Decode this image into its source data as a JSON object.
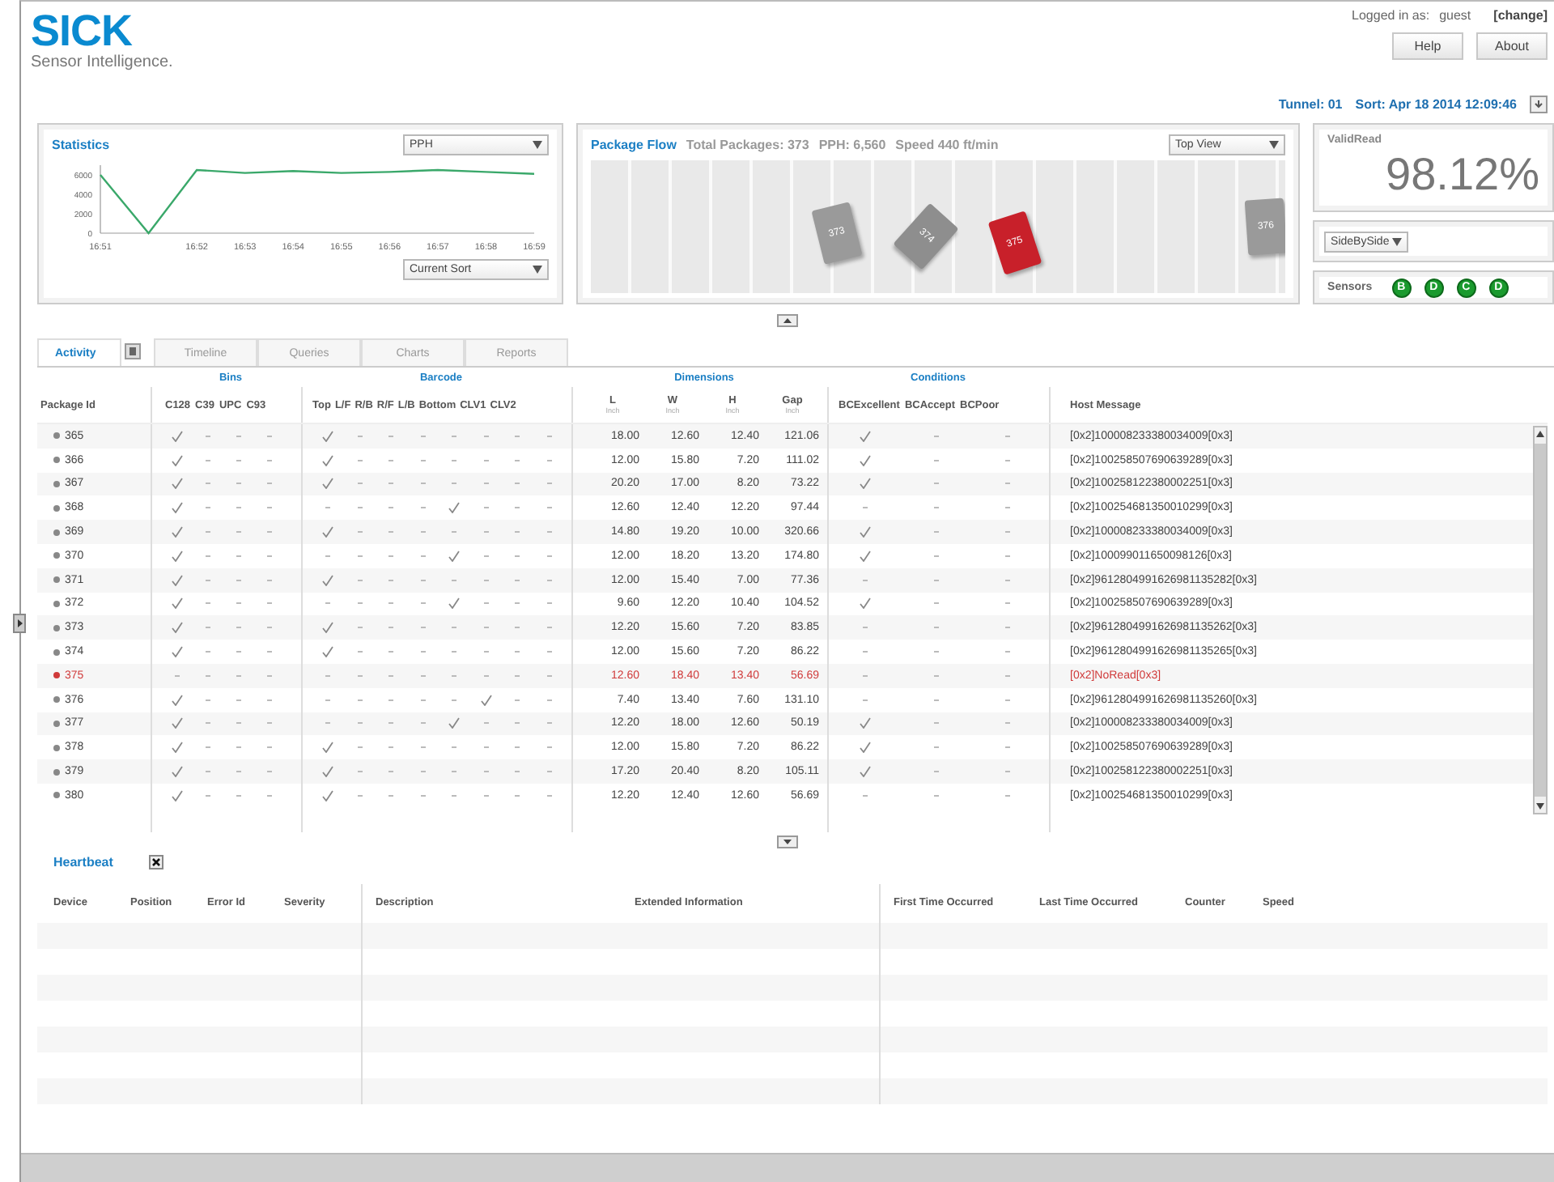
{
  "header": {
    "logo": "SICK",
    "tagline": "Sensor Intelligence.",
    "login_label": "Logged in as:",
    "user": "guest",
    "change_link": "[change]",
    "buttons": [
      "Help",
      "About"
    ],
    "tunnel": "Tunnel: 01",
    "sort": "Sort: Apr 18 2014 12:09:46"
  },
  "statistics": {
    "title": "Statistics",
    "metric_select": "PPH",
    "sort_select": "Current Sort",
    "chart_data": {
      "type": "line",
      "categories": [
        "16:51",
        null,
        "16:52",
        "16:53",
        "16:54",
        "16:55",
        "16:56",
        "16:57",
        "16:58",
        "16:59"
      ],
      "ylim": [
        0,
        7000
      ],
      "yticks": [
        0,
        2000,
        4000,
        6000
      ],
      "series": [
        {
          "color": "#3aa86a",
          "values": [
            6000,
            0,
            6500,
            6200,
            6400,
            6200,
            6300,
            6500,
            6300,
            6100
          ]
        }
      ]
    }
  },
  "package_flow": {
    "title": "Package Flow",
    "total": "Total Packages: 373",
    "pph": "PPH: 6,560",
    "speed": "Speed 440 ft/min",
    "view_select": "Top View",
    "packages": [
      {
        "label": "373",
        "color": "#9a9a9a"
      },
      {
        "label": "374",
        "color": "#8e8e8e"
      },
      {
        "label": "375",
        "color": "#c8202a"
      },
      {
        "label": "376",
        "color": "#9a9a9a"
      }
    ]
  },
  "valid_read": {
    "title": "ValidRead",
    "value": "98.12%"
  },
  "layout_select": "SideBySide",
  "sensors": {
    "label": "Sensors",
    "items": [
      {
        "letter": "B",
        "color": "#1a9a2e"
      },
      {
        "letter": "D",
        "color": "#1a9a2e"
      },
      {
        "letter": "C",
        "color": "#1a9a2e"
      },
      {
        "letter": "D",
        "color": "#1a9a2e"
      }
    ]
  },
  "tabs": [
    {
      "label": "Activity",
      "selected": true
    },
    {
      "label": "Timeline",
      "selected": false
    },
    {
      "label": "Queries",
      "selected": false
    },
    {
      "label": "Charts",
      "selected": false
    },
    {
      "label": "Reports",
      "selected": false
    }
  ],
  "activity": {
    "package_id_header": "Package Id",
    "bins": {
      "title": "Bins",
      "columns": [
        "C128",
        "C39",
        "UPC",
        "C93"
      ]
    },
    "barcode": {
      "title": "Barcode",
      "columns": [
        "Top",
        "L/F",
        "R/B",
        "R/F",
        "L/B",
        "Bottom",
        "CLV1",
        "CLV2"
      ]
    },
    "dimensions": {
      "title": "Dimensions",
      "columns": [
        {
          "label": "L",
          "unit": "Inch"
        },
        {
          "label": "W",
          "unit": "Inch"
        },
        {
          "label": "H",
          "unit": "Inch"
        },
        {
          "label": "Gap",
          "unit": "Inch"
        }
      ]
    },
    "conditions": {
      "title": "Conditions",
      "columns": [
        "BCExcellent",
        "BCAccept",
        "BCPoor"
      ]
    },
    "host_message_header": "Host Message",
    "rows": [
      {
        "id": "365",
        "error": false,
        "bins": [
          true,
          false,
          false,
          false
        ],
        "barcode": [
          true,
          false,
          false,
          false,
          false,
          false,
          false,
          false
        ],
        "dims": [
          "18.00",
          "12.60",
          "12.40",
          "121.06"
        ],
        "conditions": [
          true,
          false,
          false
        ],
        "host_message": "[0x2]100008233380034009[0x3]"
      },
      {
        "id": "366",
        "error": false,
        "bins": [
          true,
          false,
          false,
          false
        ],
        "barcode": [
          true,
          false,
          false,
          false,
          false,
          false,
          false,
          false
        ],
        "dims": [
          "12.00",
          "15.80",
          "7.20",
          "111.02"
        ],
        "conditions": [
          true,
          false,
          false
        ],
        "host_message": "[0x2]100258507690639289[0x3]"
      },
      {
        "id": "367",
        "error": false,
        "bins": [
          true,
          false,
          false,
          false
        ],
        "barcode": [
          true,
          false,
          false,
          false,
          false,
          false,
          false,
          false
        ],
        "dims": [
          "20.20",
          "17.00",
          "8.20",
          "73.22"
        ],
        "conditions": [
          true,
          false,
          false
        ],
        "host_message": "[0x2]100258122380002251[0x3]"
      },
      {
        "id": "368",
        "error": false,
        "bins": [
          true,
          false,
          false,
          false
        ],
        "barcode": [
          false,
          false,
          false,
          false,
          true,
          false,
          false,
          false
        ],
        "dims": [
          "12.60",
          "12.40",
          "12.20",
          "97.44"
        ],
        "conditions": [
          false,
          false,
          false
        ],
        "host_message": "[0x2]100254681350010299[0x3]"
      },
      {
        "id": "369",
        "error": false,
        "bins": [
          true,
          false,
          false,
          false
        ],
        "barcode": [
          true,
          false,
          false,
          false,
          false,
          false,
          false,
          false
        ],
        "dims": [
          "14.80",
          "19.20",
          "10.00",
          "320.66"
        ],
        "conditions": [
          true,
          false,
          false
        ],
        "host_message": "[0x2]100008233380034009[0x3]"
      },
      {
        "id": "370",
        "error": false,
        "bins": [
          true,
          false,
          false,
          false
        ],
        "barcode": [
          false,
          false,
          false,
          false,
          true,
          false,
          false,
          false
        ],
        "dims": [
          "12.00",
          "18.20",
          "13.20",
          "174.80"
        ],
        "conditions": [
          true,
          false,
          false
        ],
        "host_message": "[0x2]100099011650098126[0x3]"
      },
      {
        "id": "371",
        "error": false,
        "bins": [
          true,
          false,
          false,
          false
        ],
        "barcode": [
          true,
          false,
          false,
          false,
          false,
          false,
          false,
          false
        ],
        "dims": [
          "12.00",
          "15.40",
          "7.00",
          "77.36"
        ],
        "conditions": [
          false,
          false,
          false
        ],
        "host_message": "[0x2]9612804991626981135282[0x3]"
      },
      {
        "id": "372",
        "error": false,
        "bins": [
          true,
          false,
          false,
          false
        ],
        "barcode": [
          false,
          false,
          false,
          false,
          true,
          false,
          false,
          false
        ],
        "dims": [
          "9.60",
          "12.20",
          "10.40",
          "104.52"
        ],
        "conditions": [
          true,
          false,
          false
        ],
        "host_message": "[0x2]100258507690639289[0x3]"
      },
      {
        "id": "373",
        "error": false,
        "bins": [
          true,
          false,
          false,
          false
        ],
        "barcode": [
          true,
          false,
          false,
          false,
          false,
          false,
          false,
          false
        ],
        "dims": [
          "12.20",
          "15.60",
          "7.20",
          "83.85"
        ],
        "conditions": [
          false,
          false,
          false
        ],
        "host_message": "[0x2]9612804991626981135262[0x3]"
      },
      {
        "id": "374",
        "error": false,
        "bins": [
          true,
          false,
          false,
          false
        ],
        "barcode": [
          true,
          false,
          false,
          false,
          false,
          false,
          false,
          false
        ],
        "dims": [
          "12.00",
          "15.60",
          "7.20",
          "86.22"
        ],
        "conditions": [
          false,
          false,
          false
        ],
        "host_message": "[0x2]9612804991626981135265[0x3]"
      },
      {
        "id": "375",
        "error": true,
        "bins": [
          false,
          false,
          false,
          false
        ],
        "barcode": [
          false,
          false,
          false,
          false,
          false,
          false,
          false,
          false
        ],
        "dims": [
          "12.60",
          "18.40",
          "13.40",
          "56.69"
        ],
        "conditions": [
          false,
          false,
          false
        ],
        "host_message": "[0x2]NoRead[0x3]"
      },
      {
        "id": "376",
        "error": false,
        "bins": [
          true,
          false,
          false,
          false
        ],
        "barcode": [
          false,
          false,
          false,
          false,
          false,
          true,
          false,
          false
        ],
        "dims": [
          "7.40",
          "13.40",
          "7.60",
          "131.10"
        ],
        "conditions": [
          false,
          false,
          false
        ],
        "host_message": "[0x2]9612804991626981135260[0x3]"
      },
      {
        "id": "377",
        "error": false,
        "bins": [
          true,
          false,
          false,
          false
        ],
        "barcode": [
          false,
          false,
          false,
          false,
          true,
          false,
          false,
          false
        ],
        "dims": [
          "12.20",
          "18.00",
          "12.60",
          "50.19"
        ],
        "conditions": [
          true,
          false,
          false
        ],
        "host_message": "[0x2]100008233380034009[0x3]"
      },
      {
        "id": "378",
        "error": false,
        "bins": [
          true,
          false,
          false,
          false
        ],
        "barcode": [
          true,
          false,
          false,
          false,
          false,
          false,
          false,
          false
        ],
        "dims": [
          "12.00",
          "15.80",
          "7.20",
          "86.22"
        ],
        "conditions": [
          true,
          false,
          false
        ],
        "host_message": "[0x2]100258507690639289[0x3]"
      },
      {
        "id": "379",
        "error": false,
        "bins": [
          true,
          false,
          false,
          false
        ],
        "barcode": [
          true,
          false,
          false,
          false,
          false,
          false,
          false,
          false
        ],
        "dims": [
          "17.20",
          "20.40",
          "8.20",
          "105.11"
        ],
        "conditions": [
          true,
          false,
          false
        ],
        "host_message": "[0x2]100258122380002251[0x3]"
      },
      {
        "id": "380",
        "error": false,
        "bins": [
          true,
          false,
          false,
          false
        ],
        "barcode": [
          true,
          false,
          false,
          false,
          false,
          false,
          false,
          false
        ],
        "dims": [
          "12.20",
          "12.40",
          "12.60",
          "56.69"
        ],
        "conditions": [
          false,
          false,
          false
        ],
        "host_message": "[0x2]100254681350010299[0x3]"
      }
    ]
  },
  "heartbeat": {
    "title": "Heartbeat",
    "column_groups": [
      [
        "Device",
        "Position",
        "Error Id",
        "Severity"
      ],
      [
        "Description",
        "Extended Information"
      ],
      [
        "First Time Occurred",
        "Last Time Occurred",
        "Counter",
        "Speed"
      ]
    ]
  }
}
